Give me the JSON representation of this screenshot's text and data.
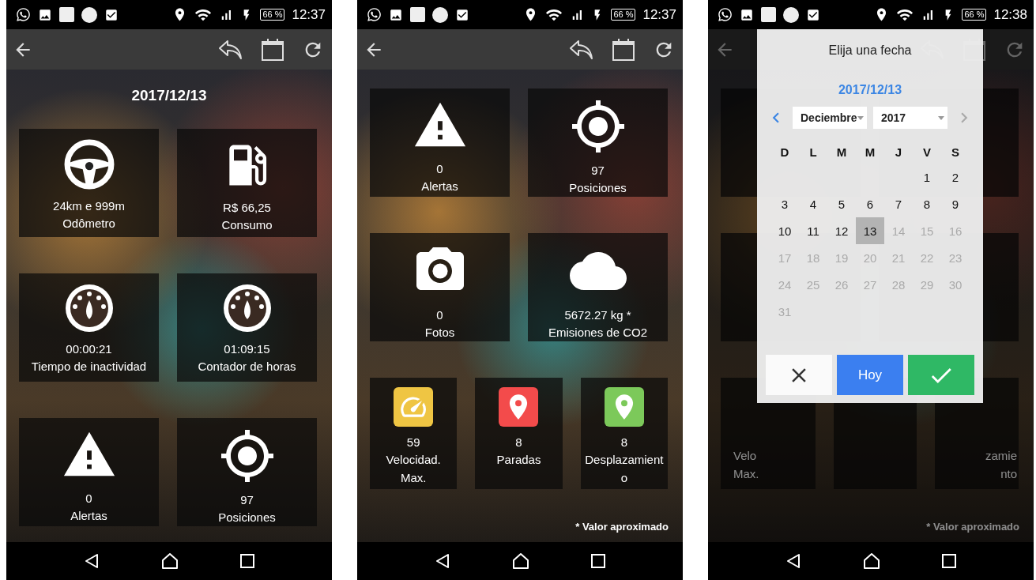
{
  "screens": [
    {
      "time": "12:37",
      "battery": "66 %",
      "dimmed": false,
      "date": "2017/12/13",
      "card_rows": [
        [
          {
            "kind": "steering",
            "value": "24km e 999m",
            "label": "Odômetro"
          },
          {
            "kind": "fuel",
            "value": "R$ 66,25",
            "label": "Consumo"
          }
        ],
        [
          {
            "kind": "dial",
            "value": "00:00:21",
            "label": "Tiempo de inactividad"
          },
          {
            "kind": "dial",
            "value": "01:09:15",
            "label": "Contador de horas"
          }
        ],
        [
          {
            "kind": "warning",
            "value": "0",
            "label": "Alertas"
          },
          {
            "kind": "target",
            "value": "97",
            "label": "Posiciones"
          }
        ]
      ]
    },
    {
      "time": "12:37",
      "battery": "66 %",
      "dimmed": false,
      "card_rows": [
        [
          {
            "kind": "warning",
            "value": "0",
            "label": "Alertas"
          },
          {
            "kind": "target",
            "value": "97",
            "label": "Posiciones"
          }
        ],
        [
          {
            "kind": "camera",
            "value": "0",
            "label": "Fotos"
          },
          {
            "kind": "cloud",
            "value": "5672.27 kg *",
            "label": "Emisiones de CO2"
          }
        ],
        [
          {
            "kind": "speed",
            "color": "#efc543",
            "value": "59",
            "label": "Velocidad. Max."
          },
          {
            "kind": "pin",
            "color": "#f34b4b",
            "value": "8",
            "label": "Paradas"
          },
          {
            "kind": "pin",
            "color": "#7cc95a",
            "value": "8",
            "label": "Desplazamiento"
          }
        ]
      ],
      "footnote": "* Valor aproximado"
    },
    {
      "time": "12:38",
      "battery": "66 %",
      "dimmed": true,
      "card_rows": [
        [
          {
            "kind": "tile"
          },
          {
            "kind": "tile"
          }
        ],
        [
          {
            "kind": "tile"
          },
          {
            "kind": "tile"
          }
        ],
        [
          {
            "kind": "tile_left",
            "lines": [
              "Velo",
              "Max."
            ]
          },
          {
            "kind": "tile"
          },
          {
            "kind": "tile_right",
            "lines": [
              "zamie",
              "nto"
            ]
          }
        ]
      ],
      "footnote": "* Valor aproximado",
      "dialog": {
        "title": "Elija una fecha",
        "date": "2017/12/13",
        "month": "Deciembre",
        "year": "2017",
        "weekdays": [
          "D",
          "L",
          "M",
          "M",
          "J",
          "V",
          "S"
        ],
        "weeks": [
          [
            {
              "kind": "blank"
            },
            {
              "kind": "blank"
            },
            {
              "kind": "blank"
            },
            {
              "kind": "blank"
            },
            {
              "kind": "blank"
            },
            {
              "kind": "day",
              "label": "1",
              "selected": false,
              "disabled": false
            },
            {
              "kind": "day",
              "label": "2",
              "selected": false,
              "disabled": false
            }
          ],
          [
            {
              "kind": "day",
              "label": "3",
              "selected": false,
              "disabled": false
            },
            {
              "kind": "day",
              "label": "4",
              "selected": false,
              "disabled": false
            },
            {
              "kind": "day",
              "label": "5",
              "selected": false,
              "disabled": false
            },
            {
              "kind": "day",
              "label": "6",
              "selected": false,
              "disabled": false
            },
            {
              "kind": "day",
              "label": "7",
              "selected": false,
              "disabled": false
            },
            {
              "kind": "day",
              "label": "8",
              "selected": false,
              "disabled": false
            },
            {
              "kind": "day",
              "label": "9",
              "selected": false,
              "disabled": false
            }
          ],
          [
            {
              "kind": "day",
              "label": "10",
              "selected": false,
              "disabled": false
            },
            {
              "kind": "day",
              "label": "11",
              "selected": false,
              "disabled": false
            },
            {
              "kind": "day",
              "label": "12",
              "selected": false,
              "disabled": false
            },
            {
              "kind": "day",
              "label": "13",
              "selected": true,
              "disabled": false
            },
            {
              "kind": "day",
              "label": "14",
              "selected": false,
              "disabled": true
            },
            {
              "kind": "day",
              "label": "15",
              "selected": false,
              "disabled": true
            },
            {
              "kind": "day",
              "label": "16",
              "selected": false,
              "disabled": true
            }
          ],
          [
            {
              "kind": "day",
              "label": "17",
              "selected": false,
              "disabled": true
            },
            {
              "kind": "day",
              "label": "18",
              "selected": false,
              "disabled": true
            },
            {
              "kind": "day",
              "label": "19",
              "selected": false,
              "disabled": true
            },
            {
              "kind": "day",
              "label": "20",
              "selected": false,
              "disabled": true
            },
            {
              "kind": "day",
              "label": "21",
              "selected": false,
              "disabled": true
            },
            {
              "kind": "day",
              "label": "22",
              "selected": false,
              "disabled": true
            },
            {
              "kind": "day",
              "label": "23",
              "selected": false,
              "disabled": true
            }
          ],
          [
            {
              "kind": "day",
              "label": "24",
              "selected": false,
              "disabled": true
            },
            {
              "kind": "day",
              "label": "25",
              "selected": false,
              "disabled": true
            },
            {
              "kind": "day",
              "label": "26",
              "selected": false,
              "disabled": true
            },
            {
              "kind": "day",
              "label": "27",
              "selected": false,
              "disabled": true
            },
            {
              "kind": "day",
              "label": "28",
              "selected": false,
              "disabled": true
            },
            {
              "kind": "day",
              "label": "29",
              "selected": false,
              "disabled": true
            },
            {
              "kind": "day",
              "label": "30",
              "selected": false,
              "disabled": true
            }
          ],
          [
            {
              "kind": "day",
              "label": "31",
              "selected": false,
              "disabled": true
            }
          ]
        ],
        "today_button": "Hoy"
      }
    }
  ]
}
